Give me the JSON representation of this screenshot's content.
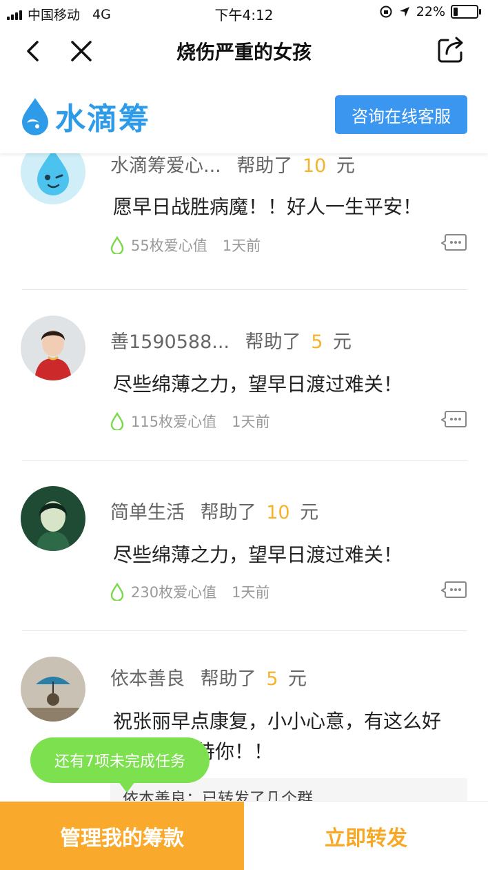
{
  "status_bar": {
    "carrier": "中国移动",
    "network": "4G",
    "time": "下午4:12",
    "battery": "22%",
    "battery_level": 0.22
  },
  "nav": {
    "title": "烧伤严重的女孩",
    "back_icon": "chevron-left-icon",
    "close_icon": "close-icon",
    "share_icon": "share-icon"
  },
  "brand": {
    "name": "水滴筹",
    "consult_label": "咨询在线客服",
    "accent_color": "#3b96ef"
  },
  "donations": [
    {
      "name": "水滴筹爱心...",
      "helped_label": "帮助了",
      "amount": "10",
      "unit": "元",
      "message": "愿早日战胜病魔！！好人一生平安！",
      "points": "55枚爱心值",
      "time": "1天前"
    },
    {
      "name": "善1590588...",
      "helped_label": "帮助了",
      "amount": "5",
      "unit": "元",
      "message": "尽些绵薄之力，望早日渡过难关！",
      "points": "115枚爱心值",
      "time": "1天前"
    },
    {
      "name": "简单生活",
      "helped_label": "帮助了",
      "amount": "10",
      "unit": "元",
      "message": "尽些绵薄之力，望早日渡过难关！",
      "points": "230枚爱心值",
      "time": "1天前"
    },
    {
      "name": "依本善良",
      "helped_label": "帮助了",
      "amount": "5",
      "unit": "元",
      "message_line1": "祝张丽早点康复，小小心意，有这么好",
      "message_line2": "待你！！",
      "reply": "依本善良：已转发了几个群"
    }
  ],
  "task_bubble": "还有7项未完成任务",
  "bottom_bar": {
    "manage_label": "管理我的筹款",
    "share_label": "立即转发",
    "manage_color": "#f9aa2d",
    "share_color": "#f7a825"
  }
}
